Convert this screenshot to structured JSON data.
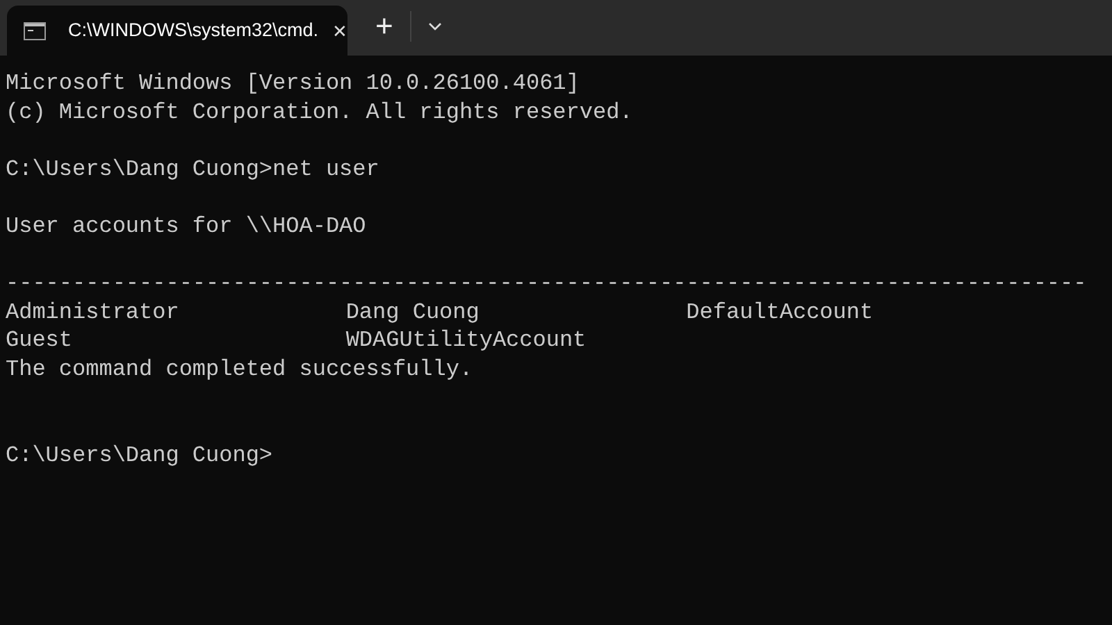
{
  "tabs": [
    {
      "title": "C:\\WINDOWS\\system32\\cmd.",
      "selected": true,
      "close": "✕"
    }
  ],
  "new_tab": "+",
  "console": [
    {
      "kind": "text",
      "text": "Microsoft Windows [Version 10.0.26100.4061]"
    },
    {
      "kind": "text",
      "text": "(c) Microsoft Corporation. All rights reserved."
    },
    {
      "kind": "blank"
    },
    {
      "kind": "text",
      "text": "C:\\Users\\Dang Cuong>net user"
    },
    {
      "kind": "blank"
    },
    {
      "kind": "text",
      "text": "User accounts for \\\\HOA-DAO"
    },
    {
      "kind": "blank"
    },
    {
      "kind": "text",
      "text": "---------------------------------------------------------------------------------"
    },
    {
      "kind": "columns",
      "cells": [
        "Administrator",
        "Dang Cuong",
        "DefaultAccount"
      ]
    },
    {
      "kind": "columns",
      "cells": [
        "Guest",
        "WDAGUtilityAccount"
      ]
    },
    {
      "kind": "text",
      "text": "The command completed successfully."
    },
    {
      "kind": "blank"
    },
    {
      "kind": "blank"
    },
    {
      "kind": "text",
      "text": "C:\\Users\\Dang Cuong>"
    }
  ]
}
